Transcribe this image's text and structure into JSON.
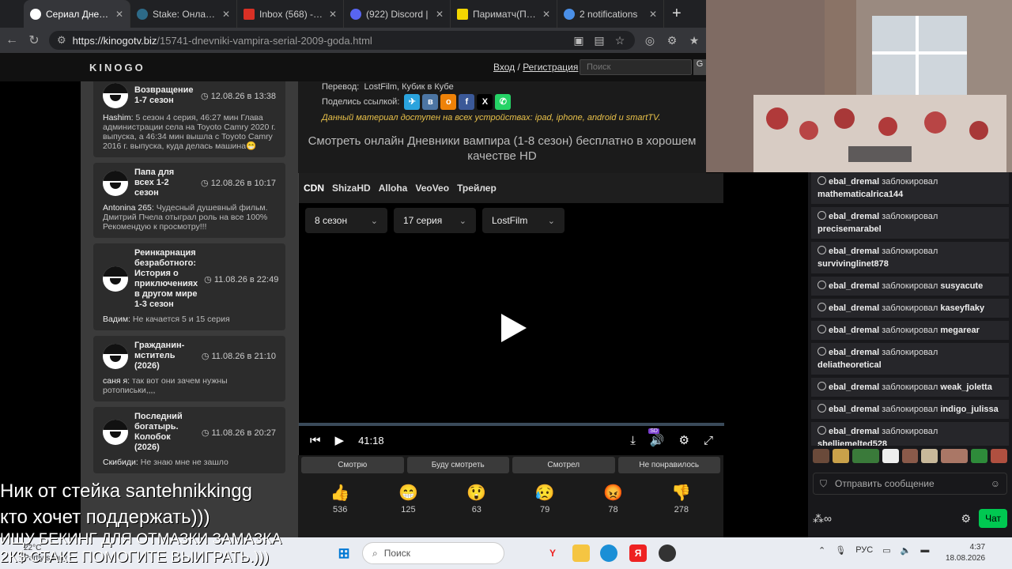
{
  "browser": {
    "tabs": [
      {
        "title": "Сериал Дневники в",
        "color": "#ffffff",
        "active": true
      },
      {
        "title": "Stake: Онлайн-кази",
        "color": "#0f2b3a"
      },
      {
        "title": "Inbox (568) - santeh",
        "color": "#d93025"
      },
      {
        "title": "(922) Discord |",
        "color": "#5865f2"
      },
      {
        "title": "Париматч(Пари ма",
        "color": "#f2d600"
      },
      {
        "title": "2 notifications",
        "color": "#4a8fe7"
      }
    ],
    "url_domain": "https://kinogotv.biz",
    "url_path": "/15741-dnevniki-vampira-serial-2009-goda.html"
  },
  "site": {
    "logo": "KINOGO",
    "login": "Вход",
    "separator": "/",
    "register": "Регистрация",
    "search_placeholder": "Поиск"
  },
  "comments": [
    {
      "title": "Возвращение 1-7 сезон",
      "date": "12.08.26 в 13:38",
      "author": "Hashim:",
      "text": "5 сезон 4 серия, 46:27 мин Глава администрации села на Toyoto Camry 2020 г. выпуска, а 46:34 мин вышла с Toyoto Camry 2016 г. выпуска, куда делась машина😁"
    },
    {
      "title": "Папа для всех 1-2 сезон",
      "date": "12.08.26 в 10:17",
      "author": "Antonina 265:",
      "text": "Чудесный душевный фильм. Дмитрий Пчела отыграл роль на все 100% Рекомендую к просмотру!!!"
    },
    {
      "title": "Реинкарнация безработного: История о приключениях в другом мире 1-3 сезон",
      "date": "11.08.26 в 22:49",
      "author": "Вадим:",
      "text": "Не качается 5 и 15 серия"
    },
    {
      "title": "Гражданин-мститель (2026)",
      "date": "11.08.26 в 21:10",
      "author": "саня я:",
      "text": "так вот они зачем нужны ротописьки,,,,"
    },
    {
      "title": "Последний богатырь. Колобок (2026)",
      "date": "11.08.26 в 20:27",
      "author": "Скибиди:",
      "text": "Не знаю мне не зашло"
    }
  ],
  "info": {
    "translation_label": "Перевод:",
    "translation_value": "LostFilm, Кубик в Кубе",
    "share_label": "Поделись ссылкой:",
    "note": "Данный материал доступен на всех устройствах: ipad, iphone, android и smartTV.",
    "watch_title": "Смотреть онлайн Дневники вампира (1-8 сезон) бесплатно в хорошем качестве HD"
  },
  "player": {
    "tabs": [
      "CDN",
      "ShizaHD",
      "Alloha",
      "VeoVeo",
      "Трейлер"
    ],
    "season": "8 сезон",
    "episode": "17 серия",
    "voice": "LostFilm",
    "time": "41:18",
    "quality_badge": "SD"
  },
  "status_buttons": [
    "Смотрю",
    "Буду смотреть",
    "Смотрел",
    "Не понравилось"
  ],
  "reactions": [
    {
      "emoji": "👍",
      "count": "536"
    },
    {
      "emoji": "😁",
      "count": "125"
    },
    {
      "emoji": "😲",
      "count": "63"
    },
    {
      "emoji": "😥",
      "count": "79"
    },
    {
      "emoji": "😡",
      "count": "78"
    },
    {
      "emoji": "👎",
      "count": "278"
    }
  ],
  "chat": {
    "actor": "ebal_dremal",
    "action": "заблокировал",
    "messages": [
      {
        "target": "mathematicalrica144"
      },
      {
        "target": "precisemarabel"
      },
      {
        "target": "survivinglinet878"
      },
      {
        "target": "susyacute"
      },
      {
        "target": "kaseyflaky"
      },
      {
        "target": "megarear"
      },
      {
        "target": "deliatheoretical"
      },
      {
        "target": "weak_joletta"
      },
      {
        "target": "indigo_julissa"
      },
      {
        "target": "shelliemelted528"
      }
    ],
    "input_placeholder": "Отправить сообщение",
    "chat_button": "Чат"
  },
  "overlay": {
    "line1": "Ник от стейка santehnikkingg",
    "line2": "кто хочет поддержать)))",
    "line3": "ИЩУ БЕКИНГ ДЛЯ ОТМАЗКИ ЗАМАЗКА",
    "line4": "2К$ СТАКЕ ПОМОГИТЕ ВЫИГРАТЬ.)))"
  },
  "taskbar": {
    "temp": "22°C",
    "weather": "Partly sunny",
    "search": "Поиск",
    "lang": "РУС",
    "time": "4:37",
    "date": "18.08.2026"
  }
}
